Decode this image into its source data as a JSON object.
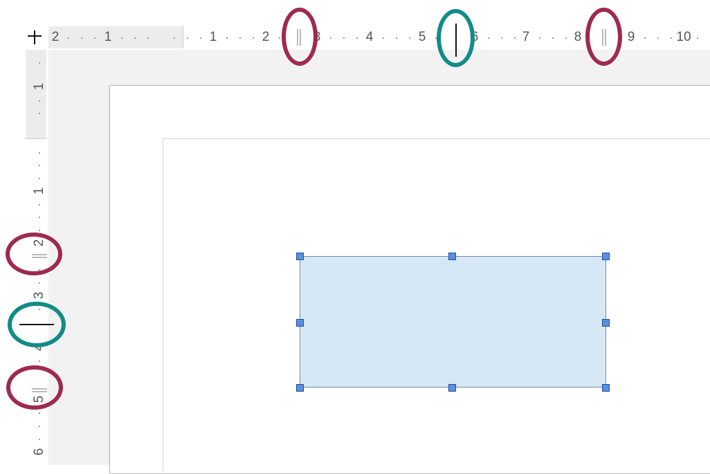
{
  "ruler_h": {
    "labels": [
      "2",
      "1",
      "1",
      "2",
      "3",
      "4",
      "5",
      "6",
      "7",
      "8",
      "9",
      "10"
    ]
  },
  "ruler_v": {
    "labels": [
      "1",
      "1",
      "2",
      "3",
      "4",
      "5",
      "6"
    ]
  },
  "colors": {
    "highlight_margin": "#9e2a50",
    "highlight_position": "#118c86",
    "shape_fill": "#d6e8f6",
    "handle_fill": "#5b8fe0"
  },
  "icons": {
    "corner": "ruler-corner-tab-icon"
  }
}
